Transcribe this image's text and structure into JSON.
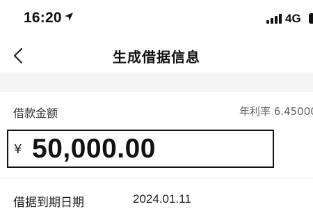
{
  "status_bar": {
    "time": "16:20",
    "network": "4G",
    "icons": [
      "location-arrow-icon",
      "signal-bars-icon",
      "battery-icon"
    ]
  },
  "nav": {
    "title": "生成借据信息",
    "back_icon": "chevron-left-icon"
  },
  "loan": {
    "amount_label": "借款金额",
    "annual_rate_text": "年利率 6.45000",
    "currency_symbol": "¥",
    "amount": "50,000.00"
  },
  "due": {
    "label": "借据到期日期",
    "date": "2024.01.11"
  }
}
